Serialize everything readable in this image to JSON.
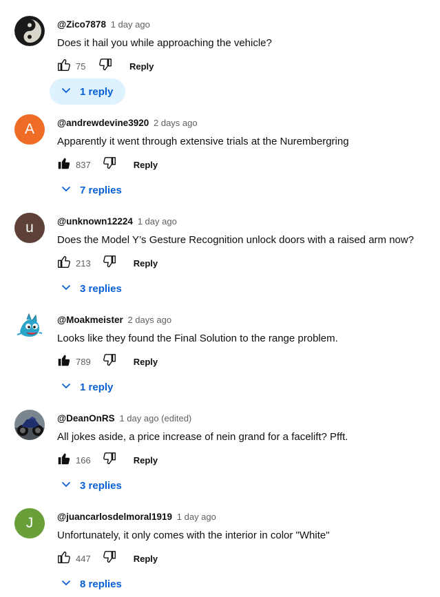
{
  "colors": {
    "link_blue": "#065fd4",
    "highlight": "#def1ff",
    "meta_gray": "#606060"
  },
  "comments": [
    {
      "author": "@Zico7878",
      "time": "1 day ago",
      "text": "Does it hail you while approaching the vehicle?",
      "likes": "75",
      "liked": false,
      "reply_label": "Reply",
      "replies": "1 reply",
      "replies_active": true,
      "avatar": {
        "kind": "image",
        "icon": "yin-yang-avatar-icon"
      }
    },
    {
      "author": "@andrewdevine3920",
      "time": "2 days ago",
      "text": "Apparently it went through extensive trials at the Nurembergring",
      "likes": "837",
      "liked": true,
      "reply_label": "Reply",
      "replies": "7 replies",
      "replies_active": false,
      "avatar": {
        "kind": "letter",
        "letter": "A",
        "color": "#ef6c26"
      }
    },
    {
      "author": "@unknown12224",
      "time": "1 day ago",
      "text": "Does the Model Y’s Gesture Recognition unlock doors with a raised arm now?",
      "likes": "213",
      "liked": false,
      "reply_label": "Reply",
      "replies": "3 replies",
      "replies_active": false,
      "avatar": {
        "kind": "letter",
        "letter": "u",
        "color": "#5d4037"
      }
    },
    {
      "author": "@Moakmeister",
      "time": "2 days ago",
      "text": "Looks like they found the Final Solution to the range problem.",
      "likes": "789",
      "liked": true,
      "reply_label": "Reply",
      "replies": "1 reply",
      "replies_active": false,
      "avatar": {
        "kind": "image",
        "icon": "cartoon-creature-avatar-icon"
      }
    },
    {
      "author": "@DeanOnRS",
      "time": "1 day ago (edited)",
      "text": "All jokes aside, a price increase of nein grand for a facelift? Pfft.",
      "likes": "166",
      "liked": true,
      "reply_label": "Reply",
      "replies": "3 replies",
      "replies_active": false,
      "avatar": {
        "kind": "image",
        "icon": "motorcycle-avatar-icon"
      }
    },
    {
      "author": "@juancarlosdelmoral1919",
      "time": "1 day ago",
      "text": "Unfortunately, it only comes with the interior in color \"White\"",
      "likes": "447",
      "liked": false,
      "reply_label": "Reply",
      "replies": "8 replies",
      "replies_active": false,
      "avatar": {
        "kind": "letter",
        "letter": "J",
        "color": "#689f38"
      }
    }
  ]
}
